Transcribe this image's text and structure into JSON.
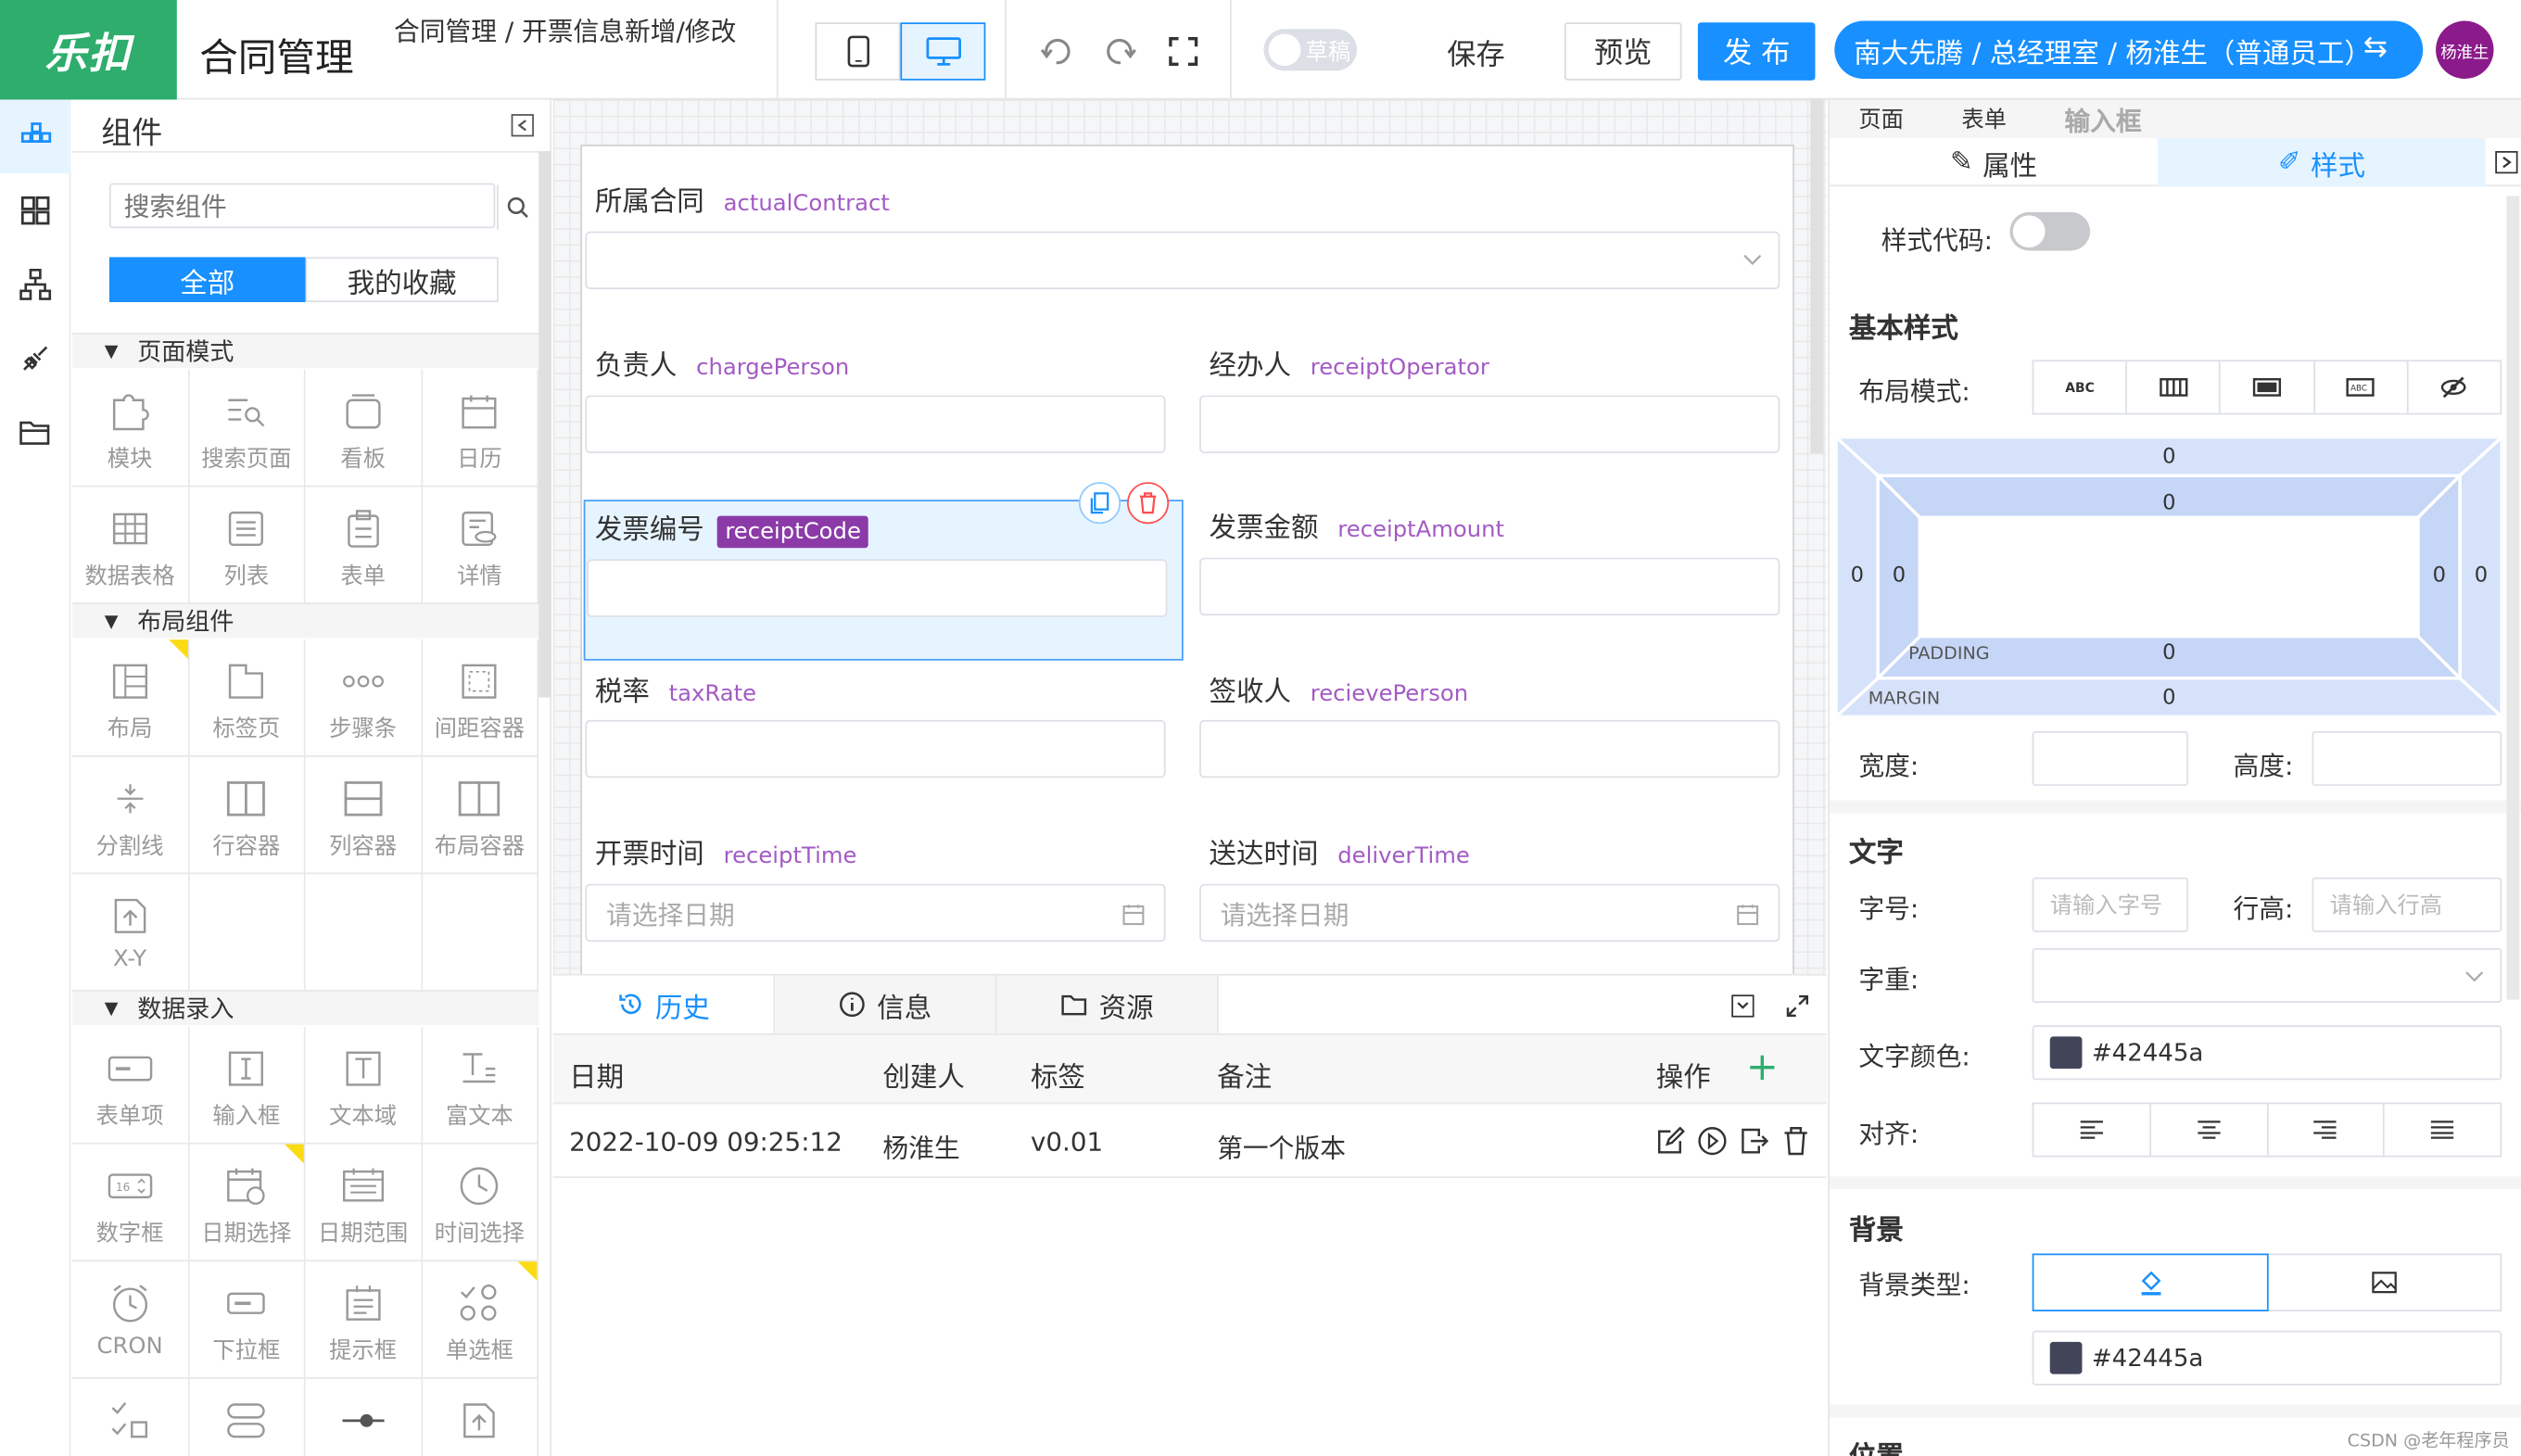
{
  "header": {
    "logo": "乐扣",
    "app_title": "合同管理",
    "breadcrumb": "合同管理 / 开票信息新增/修改",
    "draft_label": "草稿",
    "save_label": "保存",
    "preview_label": "预览",
    "publish_label": "发 布",
    "org_label": "南大先腾 / 总经理室 / 杨淮生（普通员工）",
    "switch_icon": "⇆",
    "avatar_label": "杨淮生"
  },
  "components": {
    "title": "组件",
    "search_placeholder": "搜索组件",
    "tab_all": "全部",
    "tab_fav": "我的收藏",
    "sections": [
      {
        "title": "页面模式",
        "items": [
          "模块",
          "搜索页面",
          "看板",
          "日历",
          "数据表格",
          "列表",
          "表单",
          "详情"
        ]
      },
      {
        "title": "布局组件",
        "items": [
          "布局",
          "标签页",
          "步骤条",
          "间距容器",
          "分割线",
          "行容器",
          "列容器",
          "布局容器",
          "X-Y"
        ]
      },
      {
        "title": "数据录入",
        "items": [
          "表单项",
          "输入框",
          "文本域",
          "富文本",
          "数字框",
          "日期选择",
          "日期范围",
          "时间选择",
          "CRON",
          "下拉框",
          "提示框",
          "单选框"
        ]
      }
    ]
  },
  "form": {
    "fields": [
      {
        "label": "所属合同",
        "code": "actualContract"
      },
      {
        "label": "负责人",
        "code": "chargePerson"
      },
      {
        "label": "经办人",
        "code": "receiptOperator"
      },
      {
        "label": "发票编号",
        "code": "receiptCode"
      },
      {
        "label": "发票金额",
        "code": "receiptAmount"
      },
      {
        "label": "税率",
        "code": "taxRate"
      },
      {
        "label": "签收人",
        "code": "recievePerson"
      },
      {
        "label": "开票时间",
        "code": "receiptTime"
      },
      {
        "label": "送达时间",
        "code": "deliverTime"
      }
    ],
    "date_placeholder": "请选择日期"
  },
  "bottom": {
    "tabs": [
      "历史",
      "信息",
      "资源"
    ],
    "columns": [
      "日期",
      "创建人",
      "标签",
      "备注",
      "操作"
    ],
    "rows": [
      {
        "date": "2022-10-09 09:25:12",
        "creator": "杨淮生",
        "tag": "v0.01",
        "note": "第一个版本"
      }
    ]
  },
  "right": {
    "crumbs": [
      "页面",
      "表单",
      "输入框"
    ],
    "tab_attr": "属性",
    "tab_style": "样式",
    "style_code_label": "样式代码:",
    "basic_style": "基本样式",
    "layout_mode_label": "布局模式:",
    "box": {
      "margin_label": "MARGIN",
      "padding_label": "PADDING",
      "margin_top": "0",
      "margin_bottom": "0",
      "margin_left": "0",
      "margin_right": "0",
      "padding_top": "0",
      "padding_bottom": "0",
      "padding_left": "0",
      "padding_right": "0"
    },
    "width_label": "宽度:",
    "height_label": "高度:",
    "text_section": "文字",
    "font_size_label": "字号:",
    "font_size_placeholder": "请输入字号",
    "line_height_label": "行高:",
    "line_height_placeholder": "请输入行高",
    "font_weight_label": "字重:",
    "text_color_label": "文字颜色:",
    "text_color": "#42445a",
    "align_label": "对齐:",
    "bg_section": "背景",
    "bg_type_label": "背景类型:",
    "bg_color": "#42445a",
    "position_section": "位置"
  },
  "watermark": "CSDN @老年程序员",
  "colors": {
    "primary": "#1890ff",
    "brand": "#2ead6c",
    "code": "#a35bc4",
    "chip": "#42445a"
  }
}
